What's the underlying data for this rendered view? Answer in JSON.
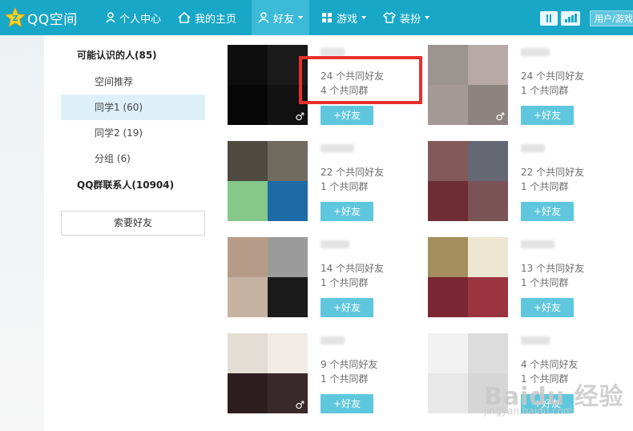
{
  "app": {
    "title": "QQ空间"
  },
  "nav": {
    "personal": "个人中心",
    "home": "我的主页",
    "friends": "好友",
    "games": "游戏",
    "dressup": "装扮",
    "search_placeholder": "用户/游戏"
  },
  "sidebar": {
    "people_you_may_know": "可能认识的人(85)",
    "items": [
      "空间推荐",
      "同学1 (60)",
      "同学2 (19)",
      "分组 (6)"
    ],
    "qq_group": "QQ群联系人(10904)",
    "ask_button": "索要好友"
  },
  "cards": [
    {
      "mutual_friends": "24 个共同好友",
      "mutual_groups": "4 个共同群",
      "add": "+好友",
      "icon": "gender-icon",
      "colors": [
        "#0e0e0e",
        "#1a1a1a",
        "#070707",
        "#121212"
      ]
    },
    {
      "mutual_friends": "24 个共同好友",
      "mutual_groups": "1 个共同群",
      "add": "+好友",
      "icon": "gender-icon",
      "colors": [
        "#9c9491",
        "#b7aaa6",
        "#a39a96",
        "#8d8480"
      ]
    },
    {
      "mutual_friends": "22 个共同好友",
      "mutual_groups": "1 个共同群",
      "add": "+好友",
      "colors": [
        "#4e4a40",
        "#706a5f",
        "#86c78a",
        "#1e6aa6"
      ]
    },
    {
      "mutual_friends": "22 个共同好友",
      "mutual_groups": "1 个共同群",
      "add": "+好友",
      "colors": [
        "#835a5a",
        "#656873",
        "#6c2e34",
        "#7a5357"
      ]
    },
    {
      "mutual_friends": "14 个共同好友",
      "mutual_groups": "1 个共同群",
      "add": "+好友",
      "colors": [
        "#b59d89",
        "#9b9b9b",
        "#c6b3a1",
        "#1b1b1b"
      ]
    },
    {
      "mutual_friends": "13 个共同好友",
      "mutual_groups": "1 个共同群",
      "add": "+好友",
      "colors": [
        "#a58e5d",
        "#ece6d1",
        "#7b2632",
        "#9a343f"
      ]
    },
    {
      "mutual_friends": "9 个共同好友",
      "mutual_groups": "1 个共同群",
      "add": "+好友",
      "icon": "gender-icon",
      "colors": [
        "#e4ddd6",
        "#f1ece6",
        "#2b1d20",
        "#3a292a"
      ]
    },
    {
      "mutual_friends": "4 个共同好友",
      "mutual_groups": "1 个共同群",
      "add": "+好友",
      "colors": [
        "#f2f2f2",
        "#dcdcdc",
        "#e8e8e8",
        "#d6d6d6"
      ]
    }
  ],
  "watermark": {
    "brand": "Baidu 经验",
    "url": "jingyan.baidu.com"
  },
  "colors": {
    "topbar": "#19a7c7",
    "add_button": "#5fc7dd",
    "highlight": "#e8302b"
  }
}
